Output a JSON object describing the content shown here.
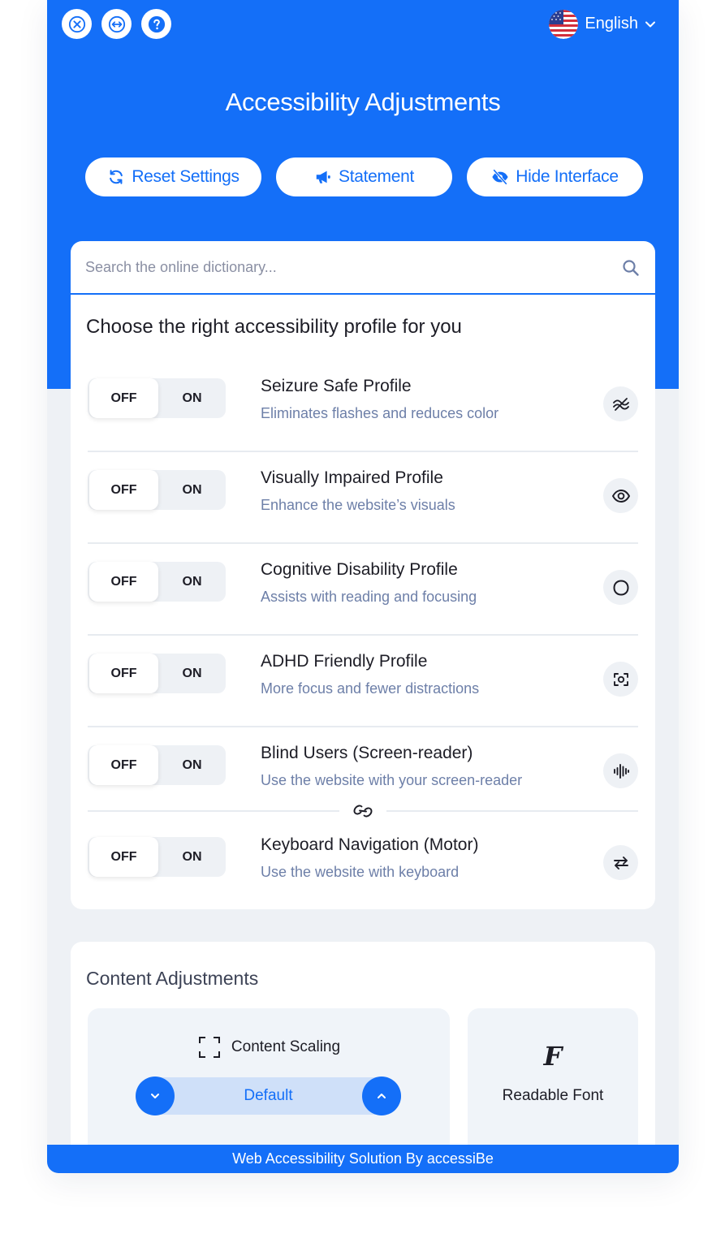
{
  "header": {
    "language": "English",
    "title": "Accessibility Adjustments",
    "actions": [
      {
        "label": "Reset Settings",
        "icon": "reset-icon"
      },
      {
        "label": "Statement",
        "icon": "megaphone-icon"
      },
      {
        "label": "Hide Interface",
        "icon": "eye-slash-icon"
      }
    ],
    "top_buttons": [
      "close-icon",
      "resize-arrows-icon",
      "help-icon"
    ]
  },
  "search": {
    "placeholder": "Search the online dictionary..."
  },
  "profiles_section": {
    "heading": "Choose the right accessibility profile for you",
    "toggle_off_label": "OFF",
    "toggle_on_label": "ON",
    "profiles": [
      {
        "title": "Seizure Safe Profile",
        "description": "Eliminates flashes and reduces color",
        "icon": "waves-icon",
        "state": "OFF"
      },
      {
        "title": "Visually Impaired Profile",
        "description": "Enhance the website’s visuals",
        "icon": "eye-icon",
        "state": "OFF"
      },
      {
        "title": "Cognitive Disability Profile",
        "description": "Assists with reading and focusing",
        "icon": "circle-icon",
        "state": "OFF"
      },
      {
        "title": "ADHD Friendly Profile",
        "description": "More focus and fewer distractions",
        "icon": "focus-target-icon",
        "state": "OFF"
      },
      {
        "title": "Blind Users (Screen-reader)",
        "description": "Use the website with your screen-reader",
        "icon": "audio-wave-icon",
        "state": "OFF"
      },
      {
        "title": "Keyboard Navigation (Motor)",
        "description": "Use the website with keyboard",
        "icon": "arrows-left-right-icon",
        "state": "OFF"
      }
    ]
  },
  "content_adjustments": {
    "heading": "Content Adjustments",
    "scaling": {
      "label": "Content Scaling",
      "value": "Default"
    },
    "readable_font": {
      "glyph": "F",
      "label": "Readable Font"
    }
  },
  "footer": {
    "text": "Web Accessibility Solution By accessiBe"
  },
  "colors": {
    "accent": "#146ff8",
    "background": "#eef1f5",
    "muted_text": "#6d7fa8"
  }
}
